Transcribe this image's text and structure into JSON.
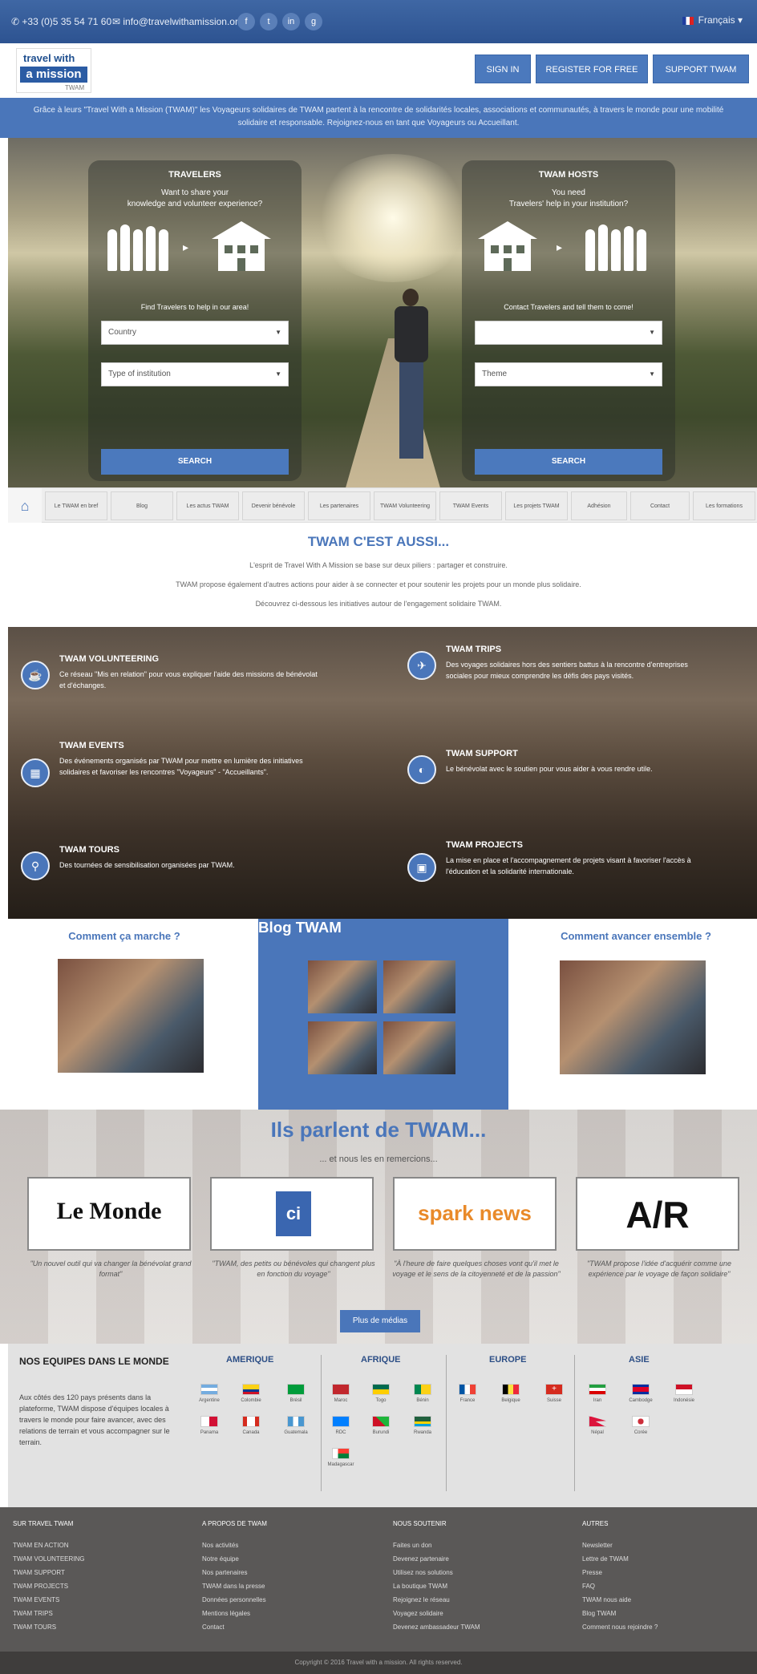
{
  "topbar": {
    "phone": "+33 (0)5 35 54 71 60",
    "email": "info@travelwithamission.org",
    "social": [
      "f",
      "t",
      "in",
      "g"
    ],
    "language": "Français ▾"
  },
  "header": {
    "logo_line1": "travel with",
    "logo_line2": "a mission",
    "logo_line3": "TWAM",
    "buttons": [
      "SIGN IN",
      "REGISTER FOR FREE",
      "SUPPORT TWAM"
    ]
  },
  "banner": "Grâce à leurs \"Travel With a Mission (TWAM)\" les Voyageurs solidaires de TWAM partent à la rencontre de solidarités locales, associations et communautés, à travers le monde pour une mobilité solidaire et responsable. Rejoignez-nous en tant que Voyageurs ou Accueillant.",
  "hero": {
    "left": {
      "title": "TRAVELERS",
      "subtitle": "Want to share your\nknowledge and volunteer experience?",
      "label": "Find Travelers to help in our area!",
      "select1": "Country",
      "select2": "Type of institution",
      "button": "SEARCH"
    },
    "right": {
      "title": "TWAM HOSTS",
      "subtitle": "You need\nTravelers' help in your institution?",
      "label": "Contact Travelers and tell them to come!",
      "select1": "",
      "select2": "Theme",
      "button": "SEARCH"
    }
  },
  "nav": {
    "items": [
      "Le TWAM en bref",
      "Blog",
      "Les actus TWAM",
      "Devenir bénévole",
      "Les partenaires",
      "TWAM Volunteering",
      "TWAM Events",
      "Les projets TWAM",
      "Adhésion",
      "Contact",
      "Les formations"
    ]
  },
  "aussi": {
    "title": "TWAM C'EST AUSSI...",
    "p1": "L'esprit de Travel With A Mission se base sur deux piliers : partager et construire.",
    "p2": "TWAM propose également d'autres actions pour aider à se connecter et pour soutenir les projets pour un monde plus solidaire.",
    "p3": "Découvrez ci-dessous les initiatives autour de l'engagement solidaire TWAM."
  },
  "services": [
    {
      "icon": "volunteer-icon",
      "glyph": "☕",
      "title": "TWAM VOLUNTEERING",
      "desc": "Ce réseau \"Mis en relation\" pour vous expliquer l'aide des missions de bénévolat et d'échanges."
    },
    {
      "icon": "plane-icon",
      "glyph": "✈",
      "title": "TWAM TRIPS",
      "desc": "Des voyages solidaires hors des sentiers battus à la rencontre d'entreprises sociales pour mieux comprendre les défis des pays visités."
    },
    {
      "icon": "calendar-icon",
      "glyph": "▦",
      "title": "TWAM EVENTS",
      "desc": "Des événements organisés par TWAM pour mettre en lumière des initiatives solidaires et favoriser les rencontres \"Voyageurs\" - \"Accueillants\"."
    },
    {
      "icon": "support-icon",
      "glyph": "◐",
      "title": "TWAM SUPPORT",
      "desc": "Le bénévolat avec le soutien pour vous aider à vous rendre utile."
    },
    {
      "icon": "location-icon",
      "glyph": "⚲",
      "title": "TWAM TOURS",
      "desc": "Des tournées de sensibilisation organisées par TWAM."
    },
    {
      "icon": "projects-icon",
      "glyph": "▣",
      "title": "TWAM PROJECTS",
      "desc": "La mise en place et l'accompagnement de projets visant à favoriser l'accès à l'éducation et la solidarité internationale."
    }
  ],
  "three": {
    "c1": "Comment ça marche ?",
    "c2": "Blog TWAM",
    "c3": "Comment avancer ensemble ?"
  },
  "parlent": {
    "title": "Ils parlent de TWAM...",
    "subtitle": "... et nous les en remercions...",
    "press": [
      {
        "name": "Le Monde",
        "quote": "\"Un nouvel outil qui va changer la bénévolat grand format\""
      },
      {
        "name": "ci",
        "quote": "\"TWAM, des petits ou bénévoles qui changent plus en fonction du voyage\""
      },
      {
        "name": "spark news",
        "quote": "\"À l'heure de faire quelques choses vont qu'il met le voyage et le sens de la citoyenneté et de la passion\""
      },
      {
        "name": "A/R",
        "quote": "\"TWAM propose l'idée d'acquérir comme une expérience par le voyage de façon solidaire\""
      }
    ],
    "button": "Plus de médias"
  },
  "equipe": {
    "title": "NOS EQUIPES DANS LE MONDE",
    "text": "Aux côtés des 120 pays présents dans la plateforme, TWAM dispose d'équipes locales à travers le monde pour faire avancer, avec des relations de terrain et vous accompagner sur le terrain.",
    "regions": [
      "AMERIQUE",
      "AFRIQUE",
      "EUROPE",
      "ASIE"
    ],
    "countries": {
      "amerique": [
        "Argentine",
        "Colombie",
        "Brésil",
        "Panama",
        "Canada",
        "Guatemala"
      ],
      "afrique": [
        "Maroc",
        "Togo",
        "Bénin",
        "RDC",
        "Burundi",
        "Rwanda",
        "Madagascar"
      ],
      "europe": [
        "France",
        "Belgique",
        "Suisse"
      ],
      "asie": [
        "Iran",
        "Cambodge",
        "Indonésie",
        "Népal",
        "Corée"
      ]
    }
  },
  "footer": {
    "cols": [
      {
        "h": "SUR TRAVEL TWAM",
        "items": [
          "TWAM EN ACTION",
          "TWAM VOLUNTEERING",
          "TWAM SUPPORT",
          "TWAM PROJECTS",
          "TWAM EVENTS",
          "TWAM TRIPS",
          "TWAM TOURS"
        ]
      },
      {
        "h": "A PROPOS DE TWAM",
        "items": [
          "Nos activités",
          "Notre équipe",
          "Nos partenaires",
          "TWAM dans la presse",
          "Données personnelles",
          "Mentions légales",
          "Contact"
        ]
      },
      {
        "h": "NOUS SOUTENIR",
        "items": [
          "Faites un don",
          "Devenez partenaire",
          "Utilisez nos solutions",
          "La boutique TWAM",
          "Rejoignez le réseau",
          "Voyagez solidaire",
          "Devenez ambassadeur TWAM"
        ]
      },
      {
        "h": "AUTRES",
        "items": [
          "Newsletter",
          "Lettre de TWAM",
          "Presse",
          "FAQ",
          "TWAM nous aide",
          "Blog TWAM",
          "Comment nous rejoindre ?"
        ]
      }
    ],
    "copyright": "Copyright © 2016 Travel with a mission. All rights reserved."
  },
  "colors": {
    "accent": "#4a76ba",
    "dark": "#2d5391"
  }
}
